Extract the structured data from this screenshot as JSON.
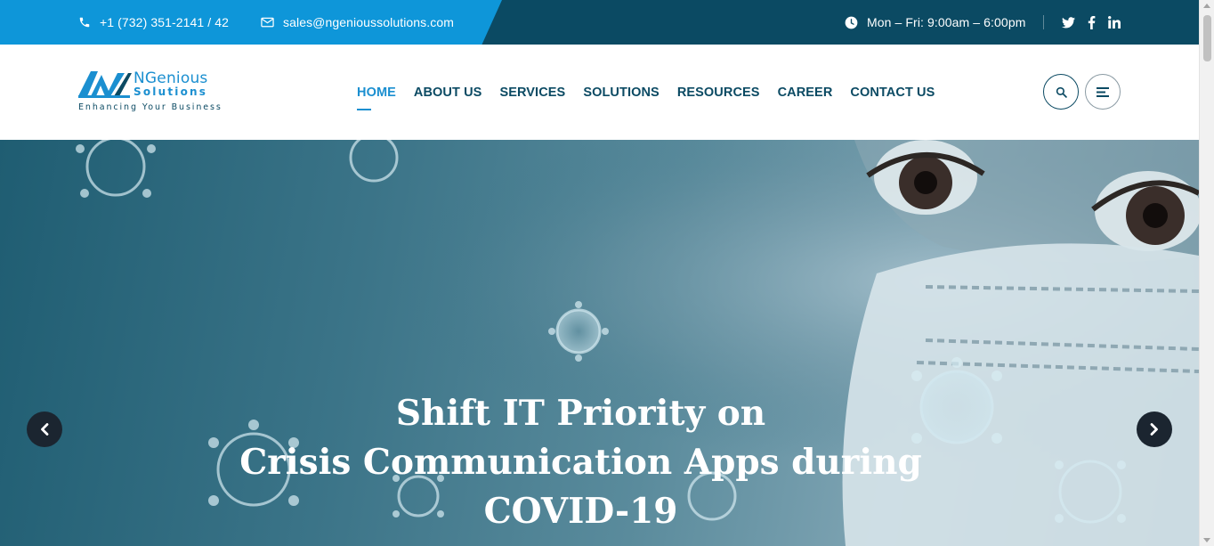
{
  "topbar": {
    "phone": "+1 (732) 351-2141 / 42",
    "phone_icon": "phone-icon",
    "email": "sales@ngenioussolutions.com",
    "email_icon": "envelope-icon",
    "hours": "Mon – Fri: 9:00am – 6:00pm",
    "hours_icon": "clock-icon",
    "social": [
      "twitter-icon",
      "facebook-icon",
      "linkedin-icon"
    ],
    "colors": {
      "primary": "#0e96d9",
      "dark": "#0b4a63"
    }
  },
  "logo": {
    "name": "NGenious",
    "sub": "Solutions",
    "tagline": "Enhancing Your Business"
  },
  "nav": {
    "items": [
      {
        "label": "HOME",
        "active": true
      },
      {
        "label": "ABOUT US"
      },
      {
        "label": "SERVICES"
      },
      {
        "label": "SOLUTIONS"
      },
      {
        "label": "RESOURCES"
      },
      {
        "label": "CAREER"
      },
      {
        "label": "CONTACT US"
      }
    ],
    "search_icon": "search-icon",
    "menu_icon": "hamburger-icon",
    "active_color": "#1b8fd0"
  },
  "hero": {
    "title_line1": "Shift IT Priority on",
    "title_line2": "Crisis Communication Apps during",
    "title_line3": "COVID-19",
    "prev_icon": "chevron-left-icon",
    "next_icon": "chevron-right-icon"
  }
}
